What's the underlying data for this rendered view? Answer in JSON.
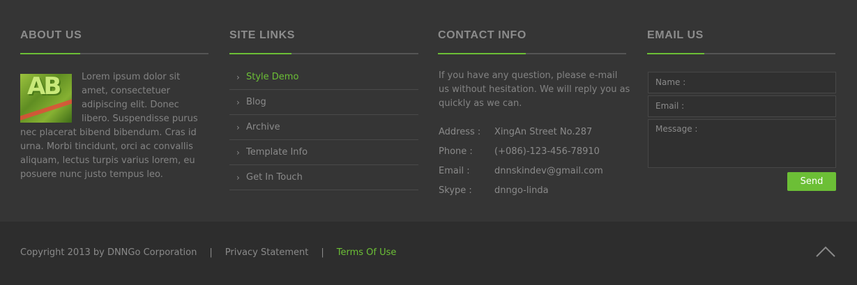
{
  "about": {
    "title": "ABOUT US",
    "text": "Lorem ipsum dolor sit amet, consectetuer adipiscing elit. Donec libero. Suspendisse purus nec placerat bibend bibendum. Cras id urna. Morbi tincidunt, orci ac convallis aliquam, lectus turpis varius lorem, eu posuere nunc justo tempus leo.",
    "thumb_text": "AB"
  },
  "site_links": {
    "title": "SITE LINKS",
    "items": [
      {
        "label": "Style Demo",
        "active": true
      },
      {
        "label": "Blog",
        "active": false
      },
      {
        "label": "Archive",
        "active": false
      },
      {
        "label": "Template Info",
        "active": false
      },
      {
        "label": "Get In Touch",
        "active": false
      }
    ]
  },
  "contact": {
    "title": "CONTACT INFO",
    "intro": "If you have any question, please e-mail us without hesitation. We will reply you as quickly as we can.",
    "rows": [
      {
        "key": "Address :",
        "value": "XingAn Street No.287"
      },
      {
        "key": "Phone :",
        "value": "(+086)-123-456-78910"
      },
      {
        "key": "Email :",
        "value": "dnnskindev@gmail.com"
      },
      {
        "key": "Skype :",
        "value": "dnngo-linda"
      }
    ]
  },
  "email_us": {
    "title": "EMAIL US",
    "name_placeholder": "Name :",
    "email_placeholder": "Email :",
    "message_placeholder": "Message :",
    "send_label": "Send"
  },
  "bottom": {
    "copyright": "Copyright 2013 by DNNGo Corporation",
    "separator": "|",
    "privacy": "Privacy Statement",
    "terms": "Terms Of Use"
  },
  "colors": {
    "accent": "#6cbf36",
    "background": "#353535",
    "bottom_bar": "#2d2d2d"
  },
  "icons": {
    "chevron": "chevron-right-icon",
    "back_to_top": "chevron-up-icon"
  }
}
